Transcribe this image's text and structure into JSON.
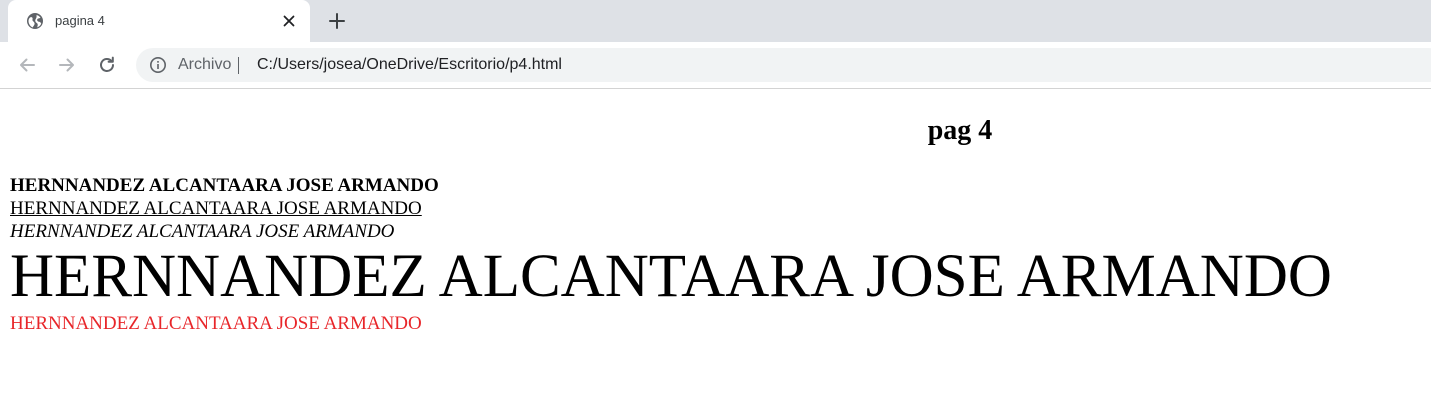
{
  "browser": {
    "tab": {
      "title": "pagina 4",
      "icon": "globe-icon",
      "close_icon": "close-icon"
    },
    "new_tab_icon": "plus-icon",
    "toolbar": {
      "back_icon": "arrow-left-icon",
      "forward_icon": "arrow-right-icon",
      "reload_icon": "reload-icon",
      "info_icon": "info-icon",
      "scheme_label": "Archivo",
      "url": "C:/Users/josea/OneDrive/Escritorio/p4.html"
    },
    "colors": {
      "tabstrip": "#dee1e6",
      "omnibox": "#f1f3f4"
    }
  },
  "page": {
    "heading": "pag 4",
    "lines": {
      "bold": "HERNNANDEZ ALCANTAARA JOSE ARMANDO",
      "underline": "HERNNANDEZ ALCANTAARA JOSE ARMANDO",
      "italic": "HERNNANDEZ ALCANTAARA JOSE ARMANDO",
      "big": "HERNNANDEZ ALCANTAARA JOSE ARMANDO",
      "red": "HERNNANDEZ ALCANTAARA JOSE ARMANDO"
    },
    "colors": {
      "red_line": "#e8262a"
    }
  }
}
